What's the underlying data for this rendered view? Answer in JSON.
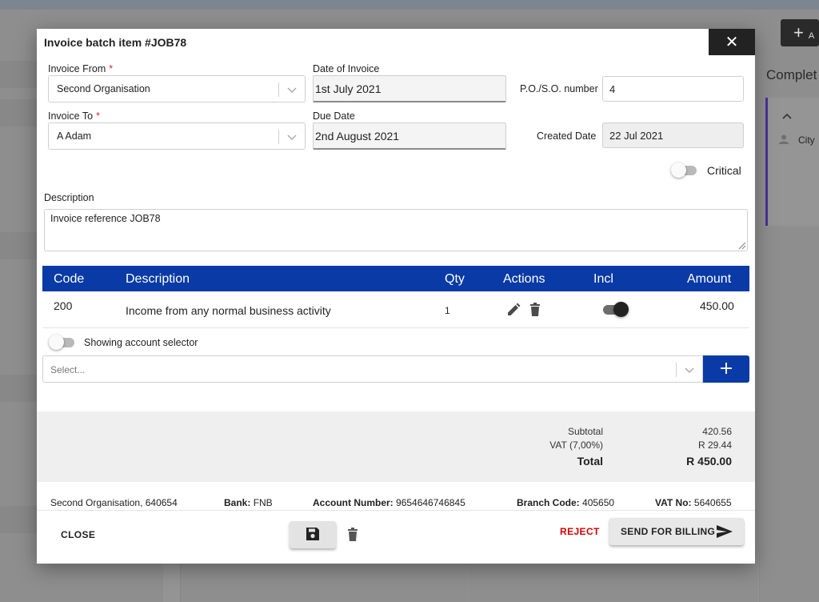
{
  "background": {
    "add_label": "A",
    "column_title": "Complet",
    "card_item": "City"
  },
  "dialog": {
    "title": "Invoice batch item #JOB78",
    "close_icon_glyph": "✕"
  },
  "form": {
    "invoice_from": {
      "label": "Invoice From",
      "required_mark": "*",
      "value": "Second Organisation"
    },
    "invoice_to": {
      "label": "Invoice To",
      "required_mark": "*",
      "value": "A Adam"
    },
    "date_of_invoice": {
      "label": "Date of Invoice",
      "value": "1st July 2021"
    },
    "due_date": {
      "label": "Due Date",
      "value": "2nd August 2021"
    },
    "po_number": {
      "label": "P.O./S.O. number",
      "value": "4"
    },
    "created_date": {
      "label": "Created Date",
      "value": "22 Jul 2021"
    },
    "critical": {
      "label": "Critical",
      "on": false
    },
    "description": {
      "label": "Description",
      "value": "Invoice reference JOB78"
    }
  },
  "table": {
    "headers": {
      "code": "Code",
      "description": "Description",
      "qty": "Qty",
      "actions": "Actions",
      "incl": "Incl",
      "amount": "Amount"
    },
    "rows": [
      {
        "code": "200",
        "description": "Income from any normal business activity",
        "qty": "1",
        "incl": true,
        "amount": "450.00"
      }
    ]
  },
  "account_selector": {
    "toggle_label": "Showing account selector",
    "toggle_on": false,
    "placeholder": "Select...",
    "add_glyph": "+"
  },
  "totals": {
    "subtotal_label": "Subtotal",
    "subtotal_value": "420.56",
    "vat_label": "VAT (7,00%)",
    "vat_value": "R 29.44",
    "total_label": "Total",
    "total_value": "R 450.00"
  },
  "bank_info": {
    "organisation": "Second Organisation, 640654",
    "bank_label": "Bank:",
    "bank_value": "FNB",
    "account_label": "Account Number:",
    "account_value": "9654646746845",
    "branch_label": "Branch Code:",
    "branch_value": "405650",
    "vat_label": "VAT No:",
    "vat_value": "5640655"
  },
  "actions": {
    "close_label": "CLOSE",
    "reject_label": "REJECT",
    "send_label": "SEND FOR BILLING"
  },
  "colors": {
    "primary": "#0a3aa5",
    "reject": "#d50000",
    "required": "#d32f2f"
  },
  "icons": [
    "close-icon",
    "chevron-down-icon",
    "pencil-icon",
    "trash-icon",
    "plus-icon",
    "save-icon",
    "send-icon",
    "person-icon",
    "resize-grip-icon"
  ]
}
